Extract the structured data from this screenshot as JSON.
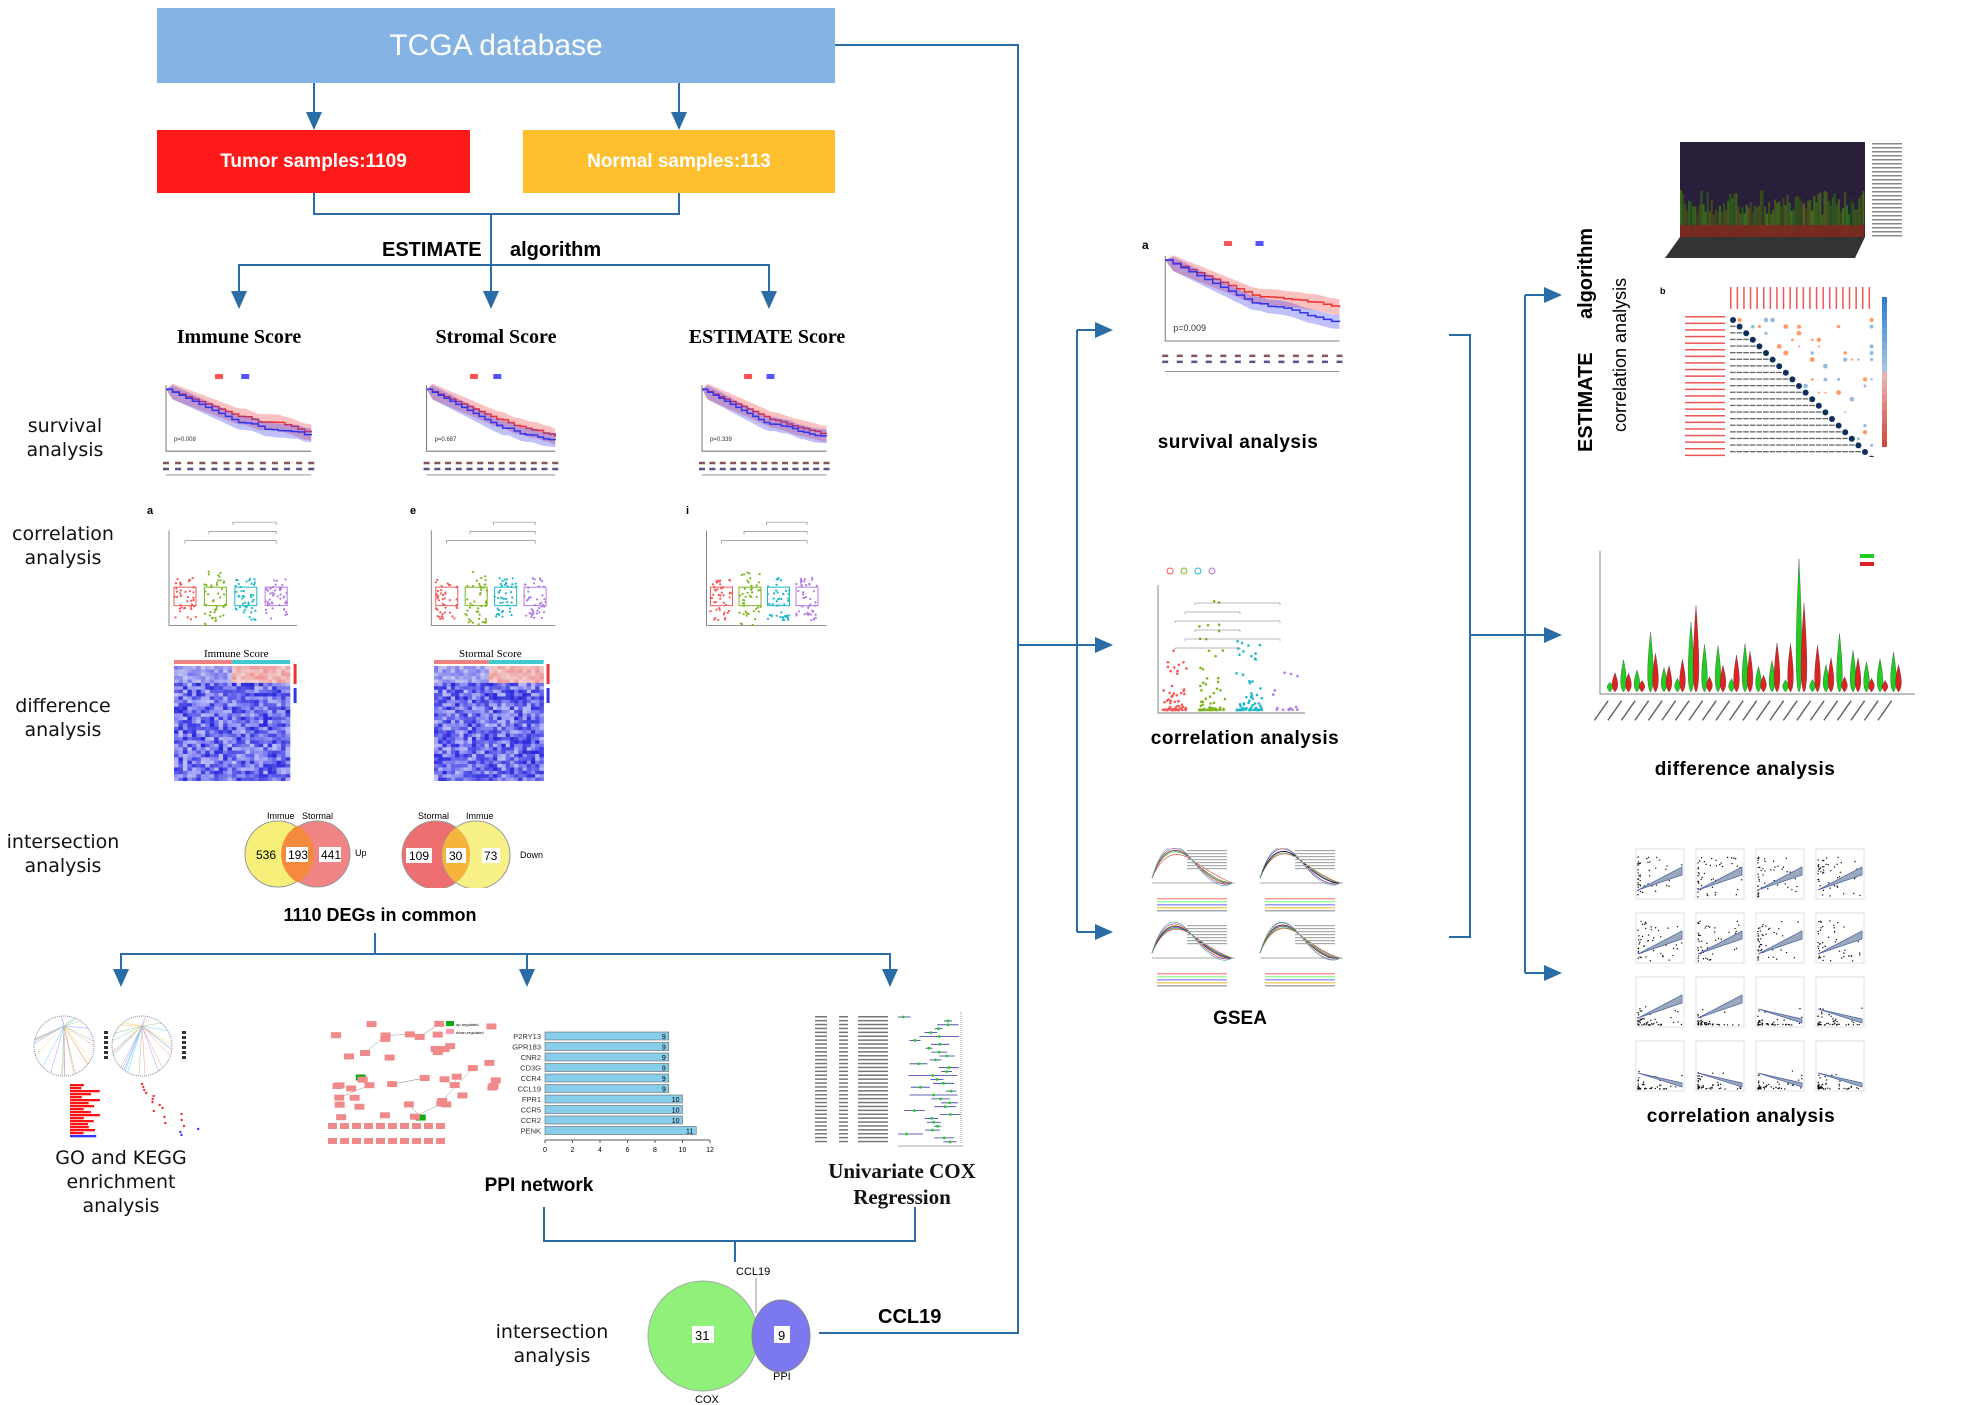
{
  "header": {
    "title": "TCGA database"
  },
  "samples": {
    "tumor": "Tumor samples:1109",
    "normal": "Normal samples:113"
  },
  "algorithm": {
    "left": "ESTIMATE",
    "right": "algorithm"
  },
  "scores": [
    {
      "title": "Immune Score",
      "pvalue": "p=0.008",
      "panel": "a",
      "heatmap_title": "Immune Score"
    },
    {
      "title": "Stromal Score",
      "pvalue": "p=0.687",
      "panel": "e",
      "heatmap_title": "Stormal Score"
    },
    {
      "title": "ESTIMATE Score",
      "pvalue": "p=0.339",
      "panel": "i"
    }
  ],
  "row_labels": {
    "survival": [
      "survival",
      "analysis"
    ],
    "correlation": [
      "correlation",
      "analysis"
    ],
    "difference": [
      "difference",
      "analysis"
    ],
    "intersection": [
      "intersection",
      "analysis"
    ]
  },
  "venn_up": {
    "left_label": "Immue",
    "right_label": "Stormal",
    "left": "536",
    "both": "193",
    "right": "441",
    "direction": "Up"
  },
  "venn_down": {
    "left_label": "Stormal",
    "right_label": "Immue",
    "left": "109",
    "both": "30",
    "right": "73",
    "direction": "Down"
  },
  "degs_common": "1110 DEGs in common",
  "go_kegg": {
    "label": [
      "GO and KEGG",
      "enrichment",
      "analysis"
    ]
  },
  "ppi": {
    "label": "PPI network",
    "legend": [
      "up-regulated",
      "down-regulated"
    ],
    "chart_data": {
      "type": "bar",
      "orientation": "horizontal",
      "categories": [
        "P2RY13",
        "GPR183",
        "CNR2",
        "CD3G",
        "CCR4",
        "CCL19",
        "FPR1",
        "CCR5",
        "CCR2",
        "PENK"
      ],
      "values": [
        9,
        9,
        9,
        9,
        9,
        9,
        10,
        10,
        10,
        11
      ],
      "xlim": [
        0,
        12
      ],
      "xticks": [
        "0",
        "2",
        "4",
        "6",
        "8",
        "10",
        "12"
      ],
      "color": "#87ceeb"
    }
  },
  "cox": {
    "label": [
      "Univariate COX",
      "Regression"
    ]
  },
  "final_venn": {
    "top_label": "CCL19",
    "left_label": "COX",
    "right_label": "PPI",
    "left": "31",
    "right": "9",
    "intersection_label": [
      "intersection",
      "analysis"
    ]
  },
  "ccl19_label": "CCL19",
  "middle": {
    "survival": {
      "label": "survival analysis",
      "pvalue": "p=0.009",
      "panel": "a"
    },
    "correlation": {
      "label": "correlation analysis"
    },
    "gsea": {
      "label": "GSEA"
    }
  },
  "right": {
    "rotated": [
      "ESTIMATE      algorithm",
      "correlation analysis"
    ],
    "corr_panel": "b",
    "difference": {
      "label": "difference analysis"
    },
    "correlation": {
      "label": "correlation analysis"
    }
  },
  "colors": {
    "tcga": "#85b3e3",
    "tumor": "#ff1a1a",
    "normal": "#fdbf2d",
    "connector": "#2a6ca6",
    "venn_yellow": "#f6f07a",
    "venn_red": "#ee6f6f",
    "venn_green": "#8ff07a",
    "venn_blue": "#7c78f0"
  }
}
